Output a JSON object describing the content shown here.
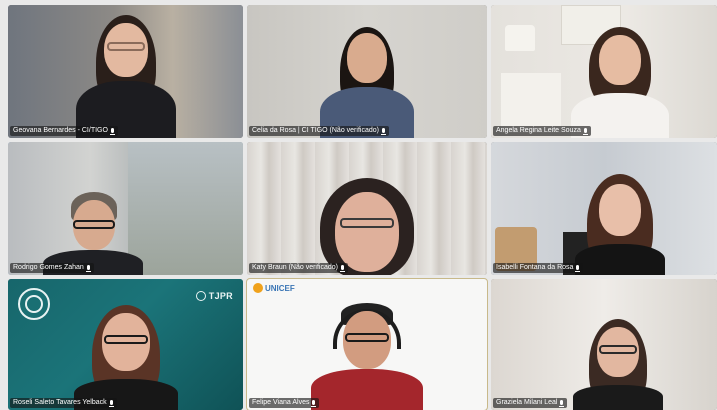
{
  "meeting": {
    "participants": [
      {
        "name": "Geovana Bernardes - CI/TIGO",
        "mic": "mic-icon"
      },
      {
        "name": "Celia da Rosa | CI TIGO (Não verificado)",
        "mic": "mic-icon"
      },
      {
        "name": "Angela Regina Leite Souza",
        "mic": "mic-icon"
      },
      {
        "name": "Rodrigo Gomes Zahan",
        "mic": "mic-icon"
      },
      {
        "name": "Katy Braun (Não verificado)",
        "mic": "mic-icon"
      },
      {
        "name": "Isabelli Fontana da Rosa",
        "mic": "mic-icon"
      },
      {
        "name": "Roseli Saleto Tavares Yelback",
        "mic": "mic-icon",
        "brand": "TJPR"
      },
      {
        "name": "Felipe Viana Alves",
        "mic": "mic-icon",
        "brand": "UNICEF"
      },
      {
        "name": "Graziela Milani Leal",
        "mic": "mic-icon"
      }
    ]
  },
  "colors": {
    "active_speaker_border": "#c8b98a",
    "tjpr_teal": "#1a6f73"
  }
}
